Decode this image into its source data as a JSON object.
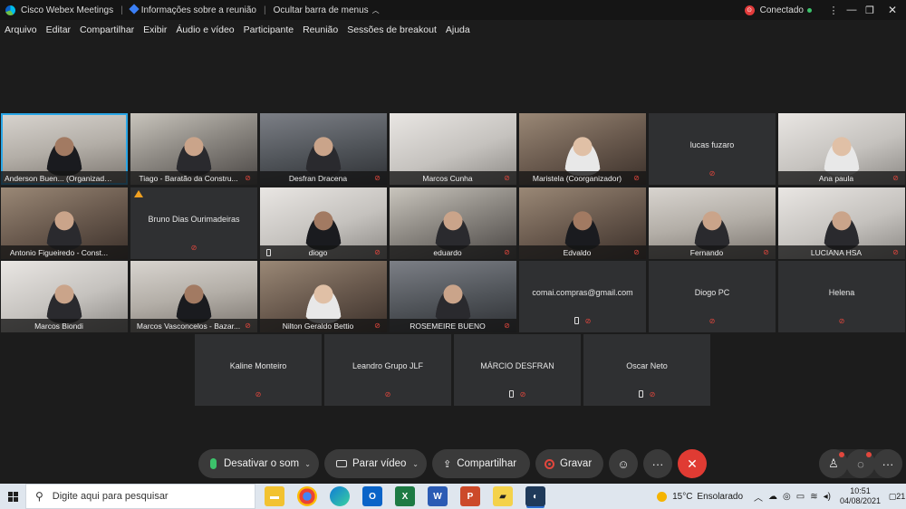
{
  "titlebar": {
    "app_name": "Cisco Webex Meetings",
    "meeting_info": "Informações sobre a reunião",
    "hide_menu": "Ocultar barra de menus",
    "status": "Conectado"
  },
  "menu": [
    "Arquivo",
    "Editar",
    "Compartilhar",
    "Exibir",
    "Áudio e vídeo",
    "Participante",
    "Reunião",
    "Sessões de breakout",
    "Ajuda"
  ],
  "participants": {
    "row1": [
      "Anderson Buen... (Organizador...)",
      "Tiago - Baratão da Constru...",
      "Desfran Dracena",
      "Marcos Cunha",
      "Maristela  (Coorganizador)",
      "lucas fuzaro",
      "Ana paula"
    ],
    "row2": [
      "Antonio Figueiredo - Const...",
      "Bruno Dias Ourimadeiras",
      "diogo",
      "eduardo",
      "Edvaldo",
      "Fernando",
      "LUCIANA HSA"
    ],
    "row3": [
      "Marcos Biondi",
      "Marcos Vasconcelos - Bazar...",
      "Nilton Geraldo Bettio",
      "ROSEMEIRE BUENO",
      "comai.compras@gmail.com",
      "Diogo PC",
      "Helena"
    ],
    "row4": [
      "Kaline Monteiro",
      "Leandro Grupo JLF",
      "MÁRCIO DESFRAN",
      "Oscar Neto"
    ]
  },
  "controls": {
    "mute": "Desativar o som",
    "stop_video": "Parar vídeo",
    "share": "Compartilhar",
    "record": "Gravar"
  },
  "taskbar": {
    "search_placeholder": "Digite aqui para pesquisar",
    "temperature": "15°C",
    "weather": "Ensolarado",
    "time": "10:51",
    "date": "04/08/2021",
    "notifications": "21"
  },
  "colors": {
    "accent_active": "#2aa6e6",
    "mic_off": "#e2473d",
    "mic_on": "#3cc36b",
    "leave": "#e03b33"
  }
}
